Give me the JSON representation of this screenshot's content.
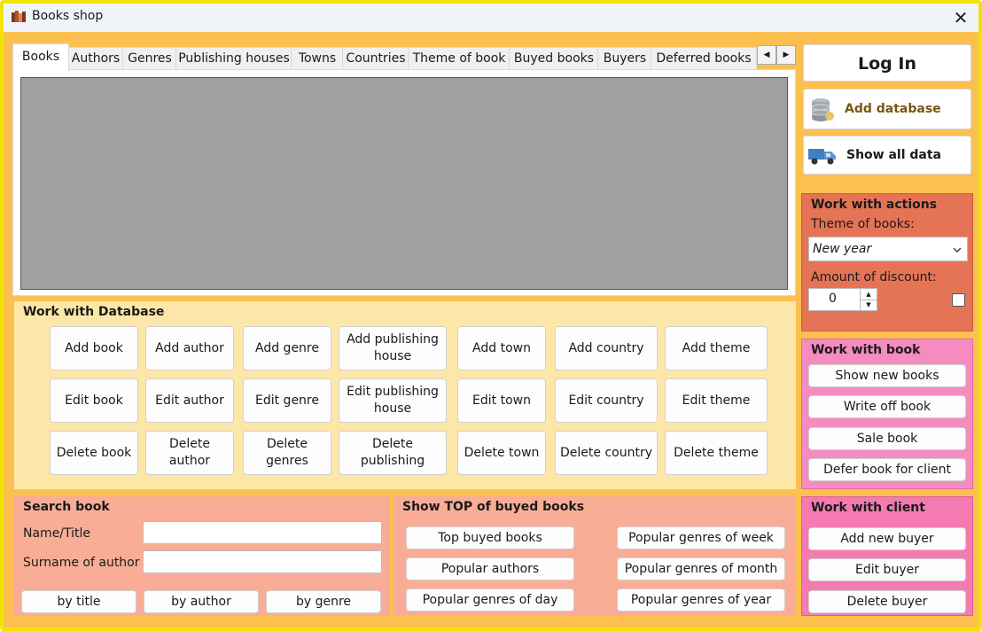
{
  "window": {
    "title": "Books shop",
    "close_glyph": "✕"
  },
  "tabs": [
    "Books",
    "Authors",
    "Genres",
    "Publishing houses",
    "Towns",
    "Countries",
    "Theme of book",
    "Buyed books",
    "Buyers",
    "Deferred books"
  ],
  "tab_scroll": {
    "left": "◀",
    "right": "▶"
  },
  "work_db": {
    "title": "Work with Database",
    "add": [
      "Add book",
      "Add author",
      "Add genre",
      "Add publishing house",
      "Add town",
      "Add country",
      "Add theme"
    ],
    "edit": [
      "Edit book",
      "Edit author",
      "Edit genre",
      "Edit publishing house",
      "Edit town",
      "Edit country",
      "Edit theme"
    ],
    "delete": [
      "Delete book",
      "Delete author",
      "Delete genres",
      "Delete publishing",
      "Delete town",
      "Delete country",
      "Delete theme"
    ]
  },
  "search": {
    "title": "Search book",
    "name_label": "Name/Title",
    "surname_label": "Surname of author",
    "name_value": "",
    "surname_value": "",
    "buttons": [
      "by title",
      "by author",
      "by genre"
    ]
  },
  "top": {
    "title": "Show TOP of buyed books",
    "left": [
      "Top buyed books",
      "Popular authors",
      "Popular genres of day"
    ],
    "right": [
      "Popular genres of week",
      "Popular genres of month",
      "Popular genres of year"
    ]
  },
  "right_panel": {
    "login": "Log In",
    "add_database": "Add database",
    "show_all": "Show all data",
    "icons": {
      "add_database": "database-icon",
      "show_all": "truck-icon"
    }
  },
  "actions": {
    "title": "Work with actions",
    "theme_label": "Theme of books:",
    "theme_value": "New year",
    "discount_label": "Amount of discount:",
    "discount_value": "0",
    "checkbox_checked": false
  },
  "work_book": {
    "title": "Work with book",
    "buttons": [
      "Show new books",
      "Write off book",
      "Sale book",
      "Defer book for client"
    ]
  },
  "work_client": {
    "title": "Work with client",
    "buttons": [
      "Add new buyer",
      "Edit buyer",
      "Delete buyer"
    ]
  },
  "colors": {
    "window_bg": "#fbc04f",
    "frame": "#f2e400",
    "db_panel": "#fde7a8",
    "search_panel": "#f9ad96",
    "actions_panel": "#e57356",
    "book_panel": "#f48cbf",
    "client_panel": "#f47ab2",
    "grid": "#a0a0a0"
  }
}
